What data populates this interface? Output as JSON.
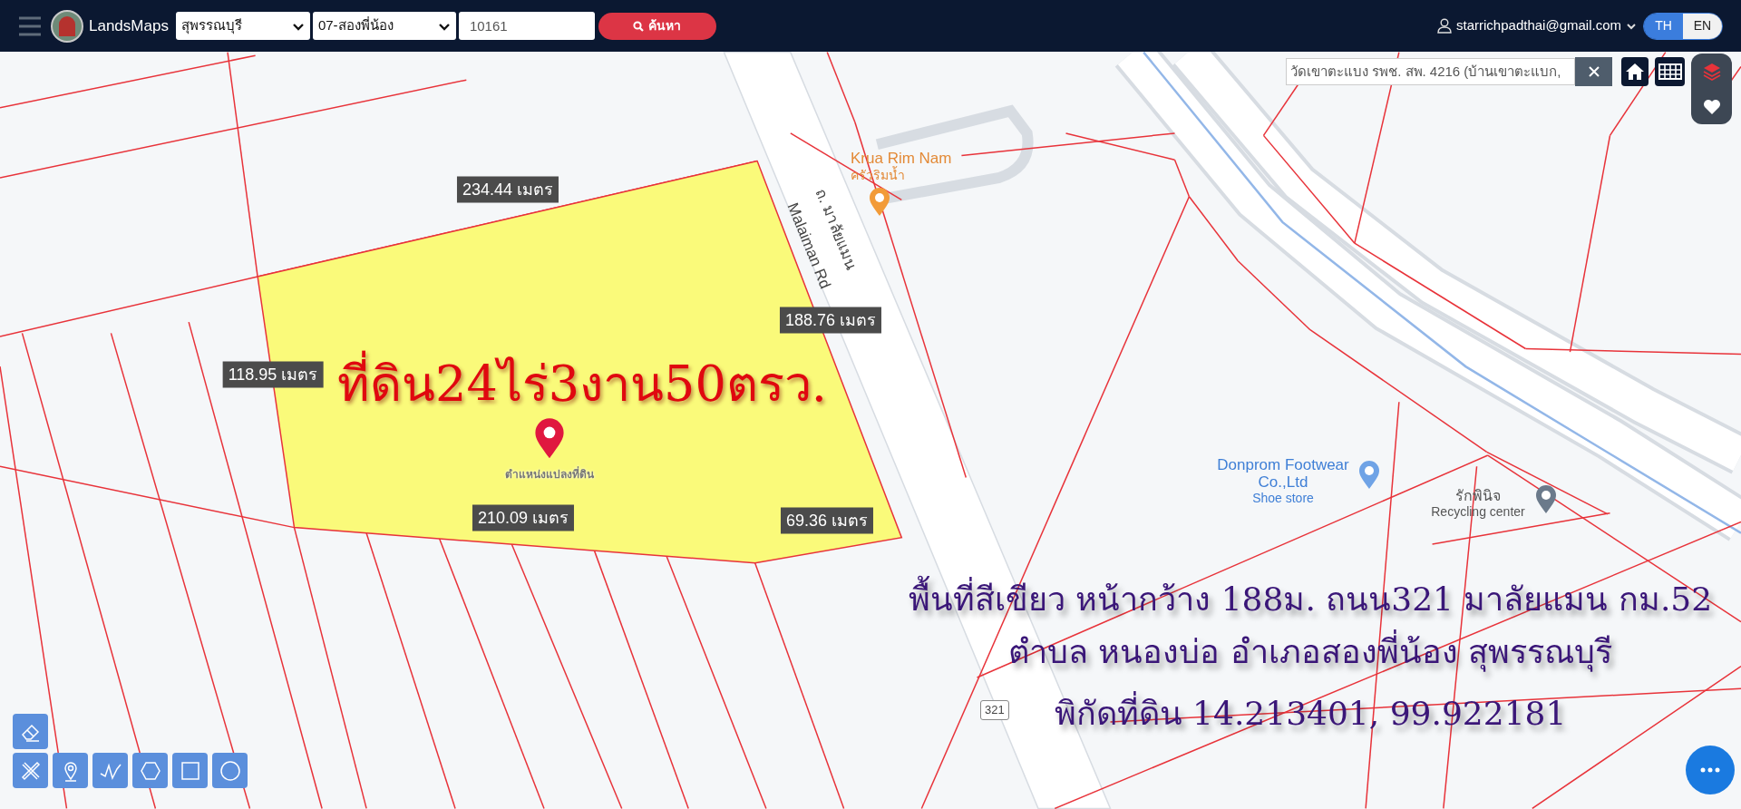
{
  "header": {
    "app_name": "LandsMaps",
    "province_select": "สุพรรณบุรี",
    "district_select": "07-สองพี่น้อง",
    "parcel_field": "10161",
    "search_button": "ค้นหา",
    "user_email": "starrichpadthai@gmail.com",
    "languages": [
      {
        "label": "TH",
        "selected": true
      },
      {
        "label": "EN",
        "selected": false
      }
    ]
  },
  "place_search": {
    "value": "วัดเขาตะแบง รพช. สพ. 4216 (บ้านเขาตะแบก,"
  },
  "map": {
    "parcel_area_label": "ที่ดิน24ไร่3งาน50ตรว.",
    "pin_label": "ตำแหน่งแปลงที่ดิน",
    "measurements": [
      "234.44 เมตร",
      "188.76 เมตร",
      "118.95 เมตร",
      "210.09 เมตร",
      "69.36 เมตร"
    ],
    "road_labels": [
      "ถ. มาลัยแมน",
      "Malaiman Rd"
    ],
    "places": [
      {
        "kind": "restaurant",
        "name": "Krua Rim Nam",
        "category": "ครัวริมน้ำ"
      },
      {
        "kind": "shop",
        "name": "Donprom Footwear Co.,Ltd",
        "category": "Shoe store"
      },
      {
        "kind": "service",
        "name": "รักพินิจ",
        "category": "Recycling center"
      }
    ],
    "route_shield": "321",
    "description_lines": [
      "พื้นที่สีเขียว หน้ากว้าง 188ม. ถนน321 มาลัยแมน กม.52",
      "ตำบล หนองบ่อ อำเภอสองพี่น้อง สุพรรณบุรี",
      "พิกัดที่ดิน 14.213401, 99.922181"
    ]
  }
}
